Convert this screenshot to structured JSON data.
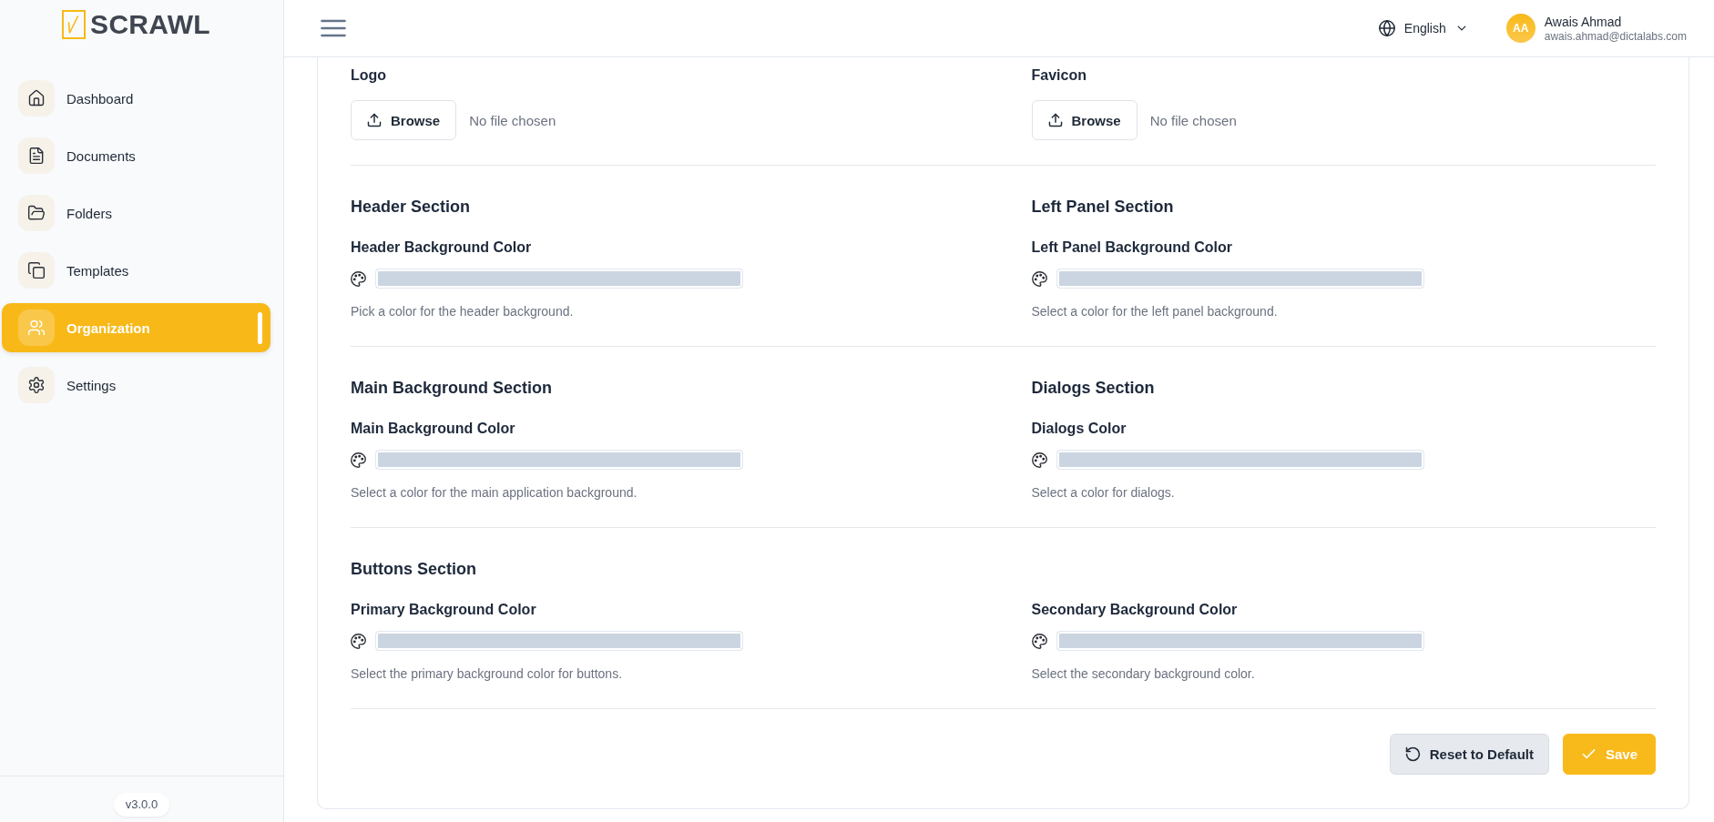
{
  "sidebar": {
    "logo": "SCRAWL",
    "items": [
      {
        "label": "Dashboard",
        "selected": false
      },
      {
        "label": "Documents",
        "selected": false
      },
      {
        "label": "Folders",
        "selected": false
      },
      {
        "label": "Templates",
        "selected": false
      },
      {
        "label": "Organization",
        "selected": true
      },
      {
        "label": "Settings",
        "selected": false
      }
    ],
    "version": "v3.0.0"
  },
  "header": {
    "language": "English",
    "user": {
      "initials": "AA",
      "name": "Awais Ahmad",
      "email": "awais.ahmad@dictalabs.com"
    }
  },
  "uploads": [
    {
      "label": "Logo",
      "button": "Browse",
      "status": "No file chosen"
    },
    {
      "label": "Favicon",
      "button": "Browse",
      "status": "No file chosen"
    }
  ],
  "sections": [
    {
      "columns": [
        {
          "heading": "Header Section",
          "label": "Header Background Color",
          "color": "#cbd5e1",
          "help": "Pick a color for the header background."
        },
        {
          "heading": "Left Panel Section",
          "label": "Left Panel Background Color",
          "color": "#cbd5e1",
          "help": "Select a color for the left panel background."
        }
      ]
    },
    {
      "columns": [
        {
          "heading": "Main Background Section",
          "label": "Main Background Color",
          "color": "#cbd5e1",
          "help": "Select a color for the main application background."
        },
        {
          "heading": "Dialogs Section",
          "label": "Dialogs Color",
          "color": "#cbd5e1",
          "help": "Select a color for dialogs."
        }
      ]
    },
    {
      "columns": [
        {
          "heading": "Buttons Section",
          "label": "Primary Background Color",
          "color": "#cbd5e1",
          "help": "Select the primary background color for buttons."
        },
        {
          "label": "Secondary Background Color",
          "color": "#cbd5e1",
          "help": "Select the secondary background color."
        }
      ]
    }
  ],
  "actions": [
    {
      "kind": "reset",
      "label": "Reset to Default"
    },
    {
      "kind": "save",
      "label": "Save"
    }
  ]
}
